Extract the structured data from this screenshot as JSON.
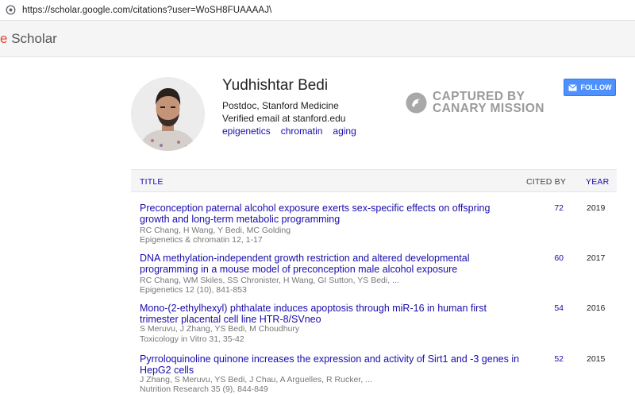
{
  "browser": {
    "url": "https://scholar.google.com/citations?user=WoSH8FUAAAAJ\\"
  },
  "header": {
    "logo_e": "e",
    "logo_text": " Scholar"
  },
  "profile": {
    "name": "Yudhishtar Bedi",
    "affiliation": "Postdoc, Stanford Medicine",
    "email": "Verified email at stanford.edu",
    "interests": [
      "epigenetics",
      "chromatin",
      "aging"
    ]
  },
  "watermark": {
    "line1": "CAPTURED BY",
    "line2": "CANARY MISSION"
  },
  "follow": {
    "label": "FOLLOW"
  },
  "table": {
    "headers": {
      "title": "TITLE",
      "cited_by": "CITED BY",
      "year": "YEAR"
    },
    "rows": [
      {
        "title": "Preconception paternal alcohol exposure exerts sex-specific effects on offspring growth and long-term metabolic programming",
        "authors": "RC Chang, H Wang, Y Bedi, MC Golding",
        "venue": "Epigenetics & chromatin 12, 1-17",
        "cited_by": "72",
        "year": "2019"
      },
      {
        "title": "DNA methylation-independent growth restriction and altered developmental programming in a mouse model of preconception male alcohol exposure",
        "authors": "RC Chang, WM Skiles, SS Chronister, H Wang, GI Sutton, YS Bedi, ...",
        "venue": "Epigenetics 12 (10), 841-853",
        "cited_by": "60",
        "year": "2017"
      },
      {
        "title": "Mono-(2-ethylhexyl) phthalate induces apoptosis through miR-16 in human first trimester placental cell line HTR-8/SVneo",
        "authors": "S Meruvu, J Zhang, YS Bedi, M Choudhury",
        "venue": "Toxicology in Vitro 31, 35-42",
        "cited_by": "54",
        "year": "2016"
      },
      {
        "title": "Pyrroloquinoline quinone increases the expression and activity of Sirt1 and -3 genes in HepG2 cells",
        "authors": "J Zhang, S Meruvu, YS Bedi, J Chau, A Arguelles, R Rucker, ...",
        "venue": "Nutrition Research 35 (9), 844-849",
        "cited_by": "52",
        "year": "2015"
      }
    ]
  }
}
